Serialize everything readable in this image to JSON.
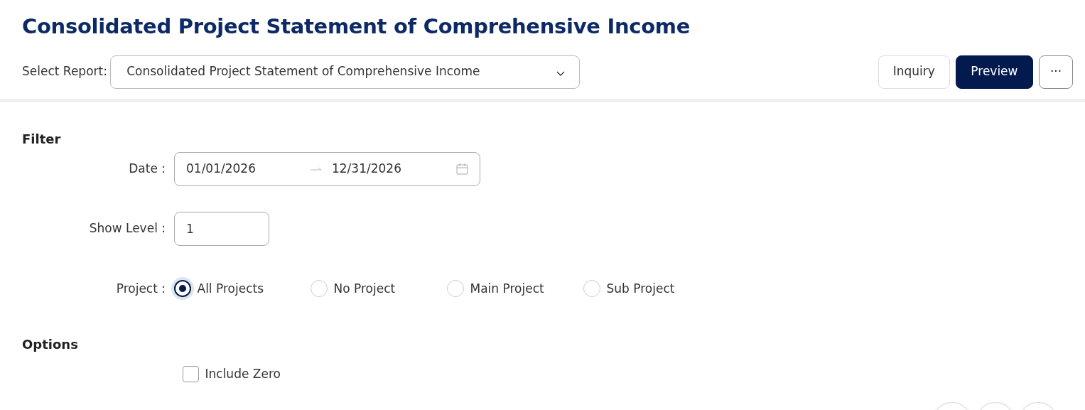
{
  "title": "Consolidated Project Statement of Comprehensive Income",
  "report_select": {
    "label": "Select Report:",
    "value": "Consolidated Project Statement of Comprehensive Income"
  },
  "actions": [
    {
      "label": "Inquiry",
      "kind": "outline"
    },
    {
      "label": "Preview",
      "kind": "primary"
    },
    {
      "label": "···",
      "kind": "more"
    }
  ],
  "filter": {
    "heading": "Filter",
    "date": {
      "label": "Date :",
      "start": "01/01/2026",
      "end": "12/31/2026"
    },
    "show_level": {
      "label": "Show Level :",
      "value": "1"
    },
    "project": {
      "label": "Project :",
      "options": [
        {
          "label": "All Projects",
          "selected": true
        },
        {
          "label": "No Project",
          "selected": false
        },
        {
          "label": "Main Project",
          "selected": false
        },
        {
          "label": "Sub Project",
          "selected": false
        }
      ]
    }
  },
  "options": {
    "heading": "Options",
    "items": [
      {
        "label": "Include Zero",
        "checked": false
      }
    ]
  }
}
